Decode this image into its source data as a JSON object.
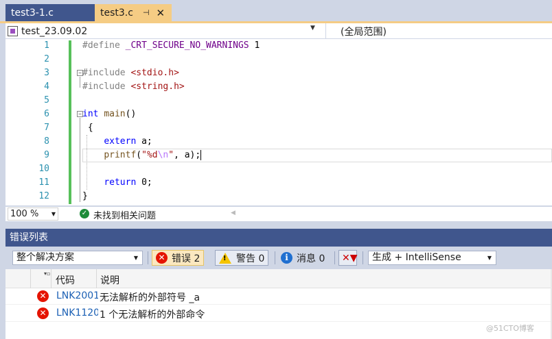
{
  "tabs": [
    {
      "label": "test3-1.c",
      "active": false
    },
    {
      "label": "test3.c",
      "active": true,
      "pin_glyph": "⊣",
      "close_glyph": "✕"
    }
  ],
  "navbar": {
    "project": "test_23.09.02",
    "scope": "(全局范围)"
  },
  "code_lines": [
    {
      "num": "1"
    },
    {
      "num": "2"
    },
    {
      "num": "3"
    },
    {
      "num": "4"
    },
    {
      "num": "5"
    },
    {
      "num": "6"
    },
    {
      "num": "7"
    },
    {
      "num": "8"
    },
    {
      "num": "9"
    },
    {
      "num": "10"
    },
    {
      "num": "11"
    },
    {
      "num": "12"
    }
  ],
  "code": {
    "l1": {
      "directive": "#define",
      "macro": "_CRT_SECURE_NO_WARNINGS",
      "value": "1"
    },
    "l3": {
      "directive": "#include",
      "header": "<stdio.h>"
    },
    "l4": {
      "directive": "#include",
      "header": "<string.h>"
    },
    "l6": {
      "type": "int",
      "name": "main",
      "parens": "()"
    },
    "l7": "{",
    "l8": {
      "kw": "extern",
      "rest": "a;"
    },
    "l9": {
      "fn": "printf",
      "open": "(",
      "q1": "\"",
      "fmt": "%d",
      "esc": "\\n",
      "q2": "\"",
      "rest": ", a);"
    },
    "l11": {
      "kw": "return",
      "rest": "0;"
    },
    "l12": "}"
  },
  "status": {
    "zoom": "100 %",
    "message": "未找到相关问题"
  },
  "error_list": {
    "title": "错误列表",
    "scope": "整个解决方案",
    "errors_label": "错误 2",
    "warnings_label": "警告 0",
    "messages_label": "消息 0",
    "build_filter": "生成 + IntelliSense",
    "columns": {
      "code": "代码",
      "description": "说明"
    },
    "rows": [
      {
        "code": "LNK2001",
        "description": "无法解析的外部符号 _a"
      },
      {
        "code": "LNK1120",
        "description": "1 个无法解析的外部命令"
      }
    ]
  },
  "watermark": "@51CTO博客",
  "colors": {
    "accent": "#f5cc84",
    "panel": "#40568d",
    "error": "#e51400",
    "warning": "#f5c400",
    "info": "#1f6fd0",
    "ok": "#1e8c3a"
  }
}
